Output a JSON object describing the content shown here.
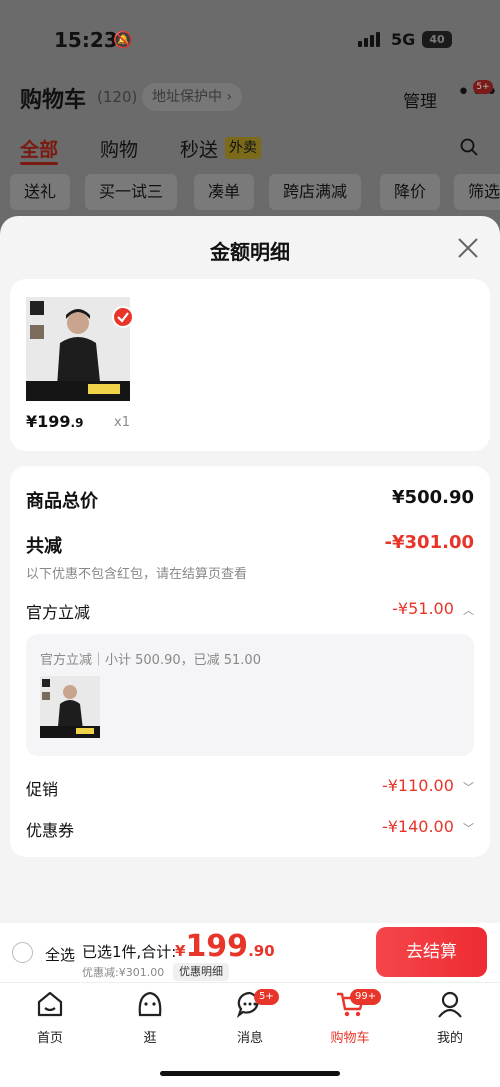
{
  "status_bar": {
    "time": "15:23",
    "network": "5G",
    "battery": "40"
  },
  "cart_header": {
    "title": "购物车",
    "count": "(120)",
    "address_protect": "地址保护中 ›",
    "manage": "管理",
    "more_badge": "5+"
  },
  "cart_tabs": [
    {
      "label": "全部"
    },
    {
      "label": "购物"
    },
    {
      "label": "秒送"
    }
  ],
  "takeout_tag": "外卖",
  "filter_chips": [
    {
      "label": "送礼"
    },
    {
      "label": "买一试三"
    },
    {
      "label": "凑单"
    },
    {
      "label": "跨店满减"
    },
    {
      "label": "降价"
    },
    {
      "label": "筛选"
    }
  ],
  "sheet": {
    "title": "金额明细",
    "product": {
      "price_main": "¥199",
      "price_dec": ".9",
      "qty": "x1"
    },
    "rows": {
      "goods_total_label": "商品总价",
      "goods_total_value": "¥500.90",
      "total_discount_label": "共减",
      "total_discount_value": "-¥301.00",
      "note": "以下优惠不包含红包，请在结算页查看",
      "official_label": "官方立减",
      "official_value": "-¥51.00",
      "official_detail": "官方立减｜小计 500.90，已减 51.00",
      "promo_label": "促销",
      "promo_value": "-¥110.00",
      "coupon_label": "优惠券",
      "coupon_value": "-¥140.00"
    }
  },
  "checkout": {
    "select_all": "全选",
    "selected_text": "已选1件,合计:",
    "total_yen": "¥",
    "total_int": "199",
    "total_dec": ".90",
    "discount_text": "优惠减:¥301.00",
    "detail_label": "优惠明细",
    "button": "去结算"
  },
  "tab_bar": [
    {
      "label": "首页"
    },
    {
      "label": "逛"
    },
    {
      "label": "消息",
      "badge": "5+"
    },
    {
      "label": "购物车",
      "badge": "99+"
    },
    {
      "label": "我的"
    }
  ],
  "colors": {
    "accent": "#e8352a",
    "background": "#f4f4f4"
  }
}
